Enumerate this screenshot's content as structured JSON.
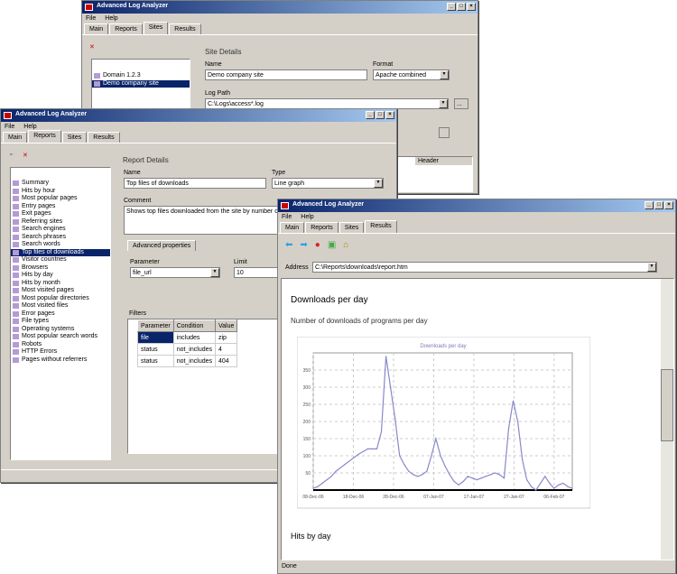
{
  "app_title": "Advanced Log Analyzer",
  "menu": [
    "File",
    "Help"
  ],
  "window_a": {
    "tabs": [
      "Main",
      "Reports",
      "Sites",
      "Results"
    ],
    "active_tab": 2,
    "sites": [
      "Domain 1.2.3",
      "Demo company site"
    ],
    "selected_site": 1,
    "section": "Site Details",
    "name_label": "Name",
    "name_value": "Demo company site",
    "format_label": "Format",
    "format_value": "Apache combined",
    "logpath_label": "Log Path",
    "logpath_value": "C:\\Logs\\access*.log",
    "table_header": "Header"
  },
  "window_b": {
    "tabs": [
      "Main",
      "Reports",
      "Sites",
      "Results"
    ],
    "active_tab": 1,
    "reports": [
      "Summary",
      "Hits by hour",
      "Most popular pages",
      "Entry pages",
      "Exit pages",
      "Referring sites",
      "Search engines",
      "Search phrases",
      "Search words",
      "Top files of downloads",
      "Visitor countries",
      "Browsers",
      "Hits by day",
      "Hits by month",
      "Most visited pages",
      "Most popular directories",
      "Most visited files",
      "Error pages",
      "File types",
      "Operating systems",
      "Most popular search words",
      "Robots",
      "HTTP Errors",
      "Pages without referrers"
    ],
    "selected_report": 9,
    "section": "Report Details",
    "name_label": "Name",
    "name_value": "Top files of downloads",
    "type_label": "Type",
    "type_value": "Line graph",
    "comment_label": "Comment",
    "comment_value": "Shows top files downloaded from the site by number of requests",
    "subtab": "Advanced properties",
    "parameter_label": "Parameter",
    "parameter_value": "file_url",
    "limit_label": "Limit",
    "limit_value": "10",
    "filters_label": "Filters",
    "columns": [
      "Parameter",
      "Condition",
      "Value"
    ],
    "rows": [
      [
        "file",
        "includes",
        "zip"
      ],
      [
        "status",
        "not_includes",
        "4"
      ],
      [
        "status",
        "not_includes",
        "404"
      ]
    ]
  },
  "window_c": {
    "tabs": [
      "Main",
      "Reports",
      "Sites",
      "Results"
    ],
    "active_tab": 3,
    "toolbar": [
      "back-icon",
      "forward-icon",
      "stop-icon",
      "refresh-icon",
      "home-icon"
    ],
    "address_label": "Address",
    "address_value": "C:\\Reports\\downloads\\report.htm",
    "heading": "Downloads per day",
    "description": "Number of downloads of programs per day",
    "heading2": "Hits by day",
    "status": "Done"
  },
  "chart_data": {
    "type": "line",
    "title": "Downloads per day",
    "xlabel": "",
    "ylabel": "",
    "ylim": [
      0,
      400
    ],
    "yticks": [
      50,
      100,
      150,
      200,
      250,
      300,
      350
    ],
    "xtick_labels": [
      "08-Dec-06",
      "18-Dec-06",
      "28-Dec-06",
      "07-Jan-07",
      "17-Jan-07",
      "27-Jan-07",
      "06-Feb-07"
    ],
    "grid": true,
    "series": [
      {
        "name": "Downloads",
        "color": "#8888cc",
        "values": [
          5,
          10,
          20,
          30,
          40,
          55,
          65,
          75,
          85,
          95,
          105,
          112,
          120,
          120,
          120,
          170,
          390,
          300,
          210,
          100,
          75,
          55,
          45,
          40,
          45,
          55,
          100,
          150,
          100,
          70,
          45,
          25,
          15,
          25,
          40,
          35,
          30,
          35,
          40,
          45,
          50,
          45,
          35,
          180,
          260,
          200,
          90,
          30,
          10,
          0,
          20,
          40,
          20,
          5,
          15,
          20,
          10,
          5
        ]
      }
    ]
  }
}
